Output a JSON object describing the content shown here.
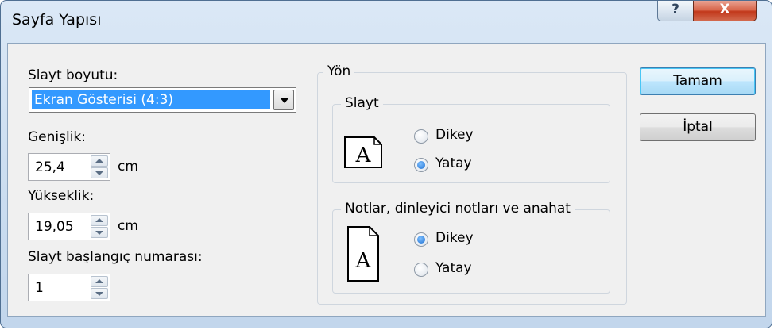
{
  "window": {
    "title": "Sayfa Yapısı",
    "help_label": "?",
    "close_label": "X"
  },
  "slide_size": {
    "label": "Slayt boyutu:",
    "value": "Ekran Gösterisi (4:3)"
  },
  "width": {
    "label": "Genişlik:",
    "value": "25,4",
    "unit": "cm"
  },
  "height": {
    "label": "Yükseklik:",
    "value": "19,05",
    "unit": "cm"
  },
  "start_number": {
    "label": "Slayt başlangıç numarası:",
    "value": "1"
  },
  "orientation": {
    "title": "Yön",
    "slides": {
      "title": "Slayt",
      "portrait_label": "Dikey",
      "landscape_label": "Yatay",
      "selected": "landscape"
    },
    "notes": {
      "title": "Notlar, dinleyici notları ve anahat",
      "portrait_label": "Dikey",
      "landscape_label": "Yatay",
      "selected": "portrait"
    },
    "icon_letter": "A"
  },
  "buttons": {
    "ok": "Tamam",
    "cancel": "İptal"
  }
}
